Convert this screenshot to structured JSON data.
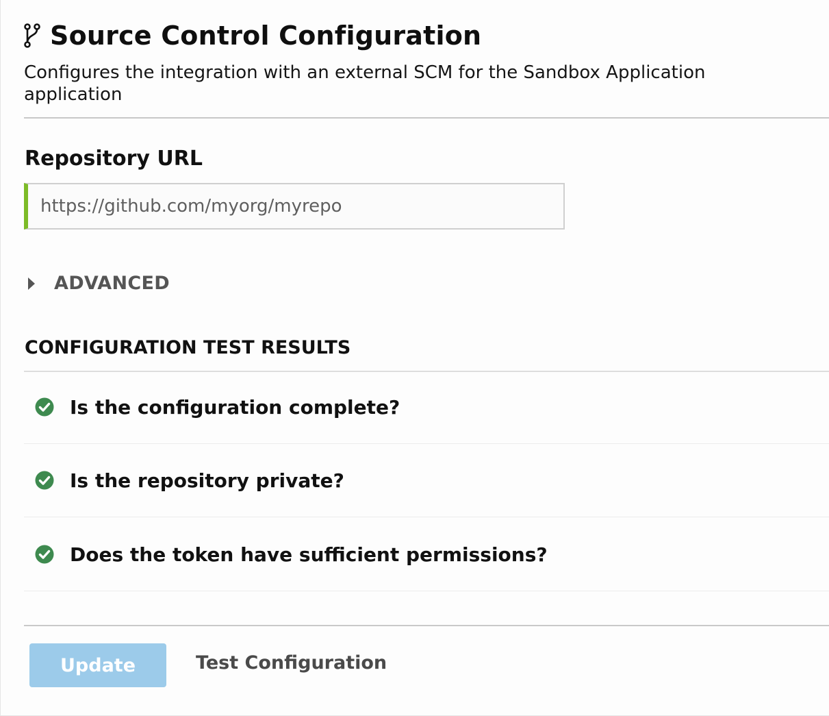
{
  "header": {
    "icon": "git-branch-icon",
    "title": "Source Control Configuration",
    "subtitle": "Configures the integration with an external SCM for the Sandbox Application application"
  },
  "repository": {
    "label": "Repository URL",
    "placeholder": "https://github.com/myorg/myrepo",
    "value": ""
  },
  "advanced": {
    "icon": "caret-right-icon",
    "label": "ADVANCED",
    "expanded": false
  },
  "results": {
    "heading": "CONFIGURATION TEST RESULTS",
    "items": [
      {
        "icon": "check-circle-icon",
        "status": "pass",
        "label": "Is the configuration complete?"
      },
      {
        "icon": "check-circle-icon",
        "status": "pass",
        "label": "Is the repository private?"
      },
      {
        "icon": "check-circle-icon",
        "status": "pass",
        "label": "Does the token have sufficient permissions?"
      }
    ]
  },
  "actions": {
    "update_label": "Update",
    "update_disabled": true,
    "test_label": "Test Configuration"
  },
  "colors": {
    "accent_green": "#7dbb28",
    "check_green": "#3e8a4f",
    "update_button": "#9ccbea"
  }
}
